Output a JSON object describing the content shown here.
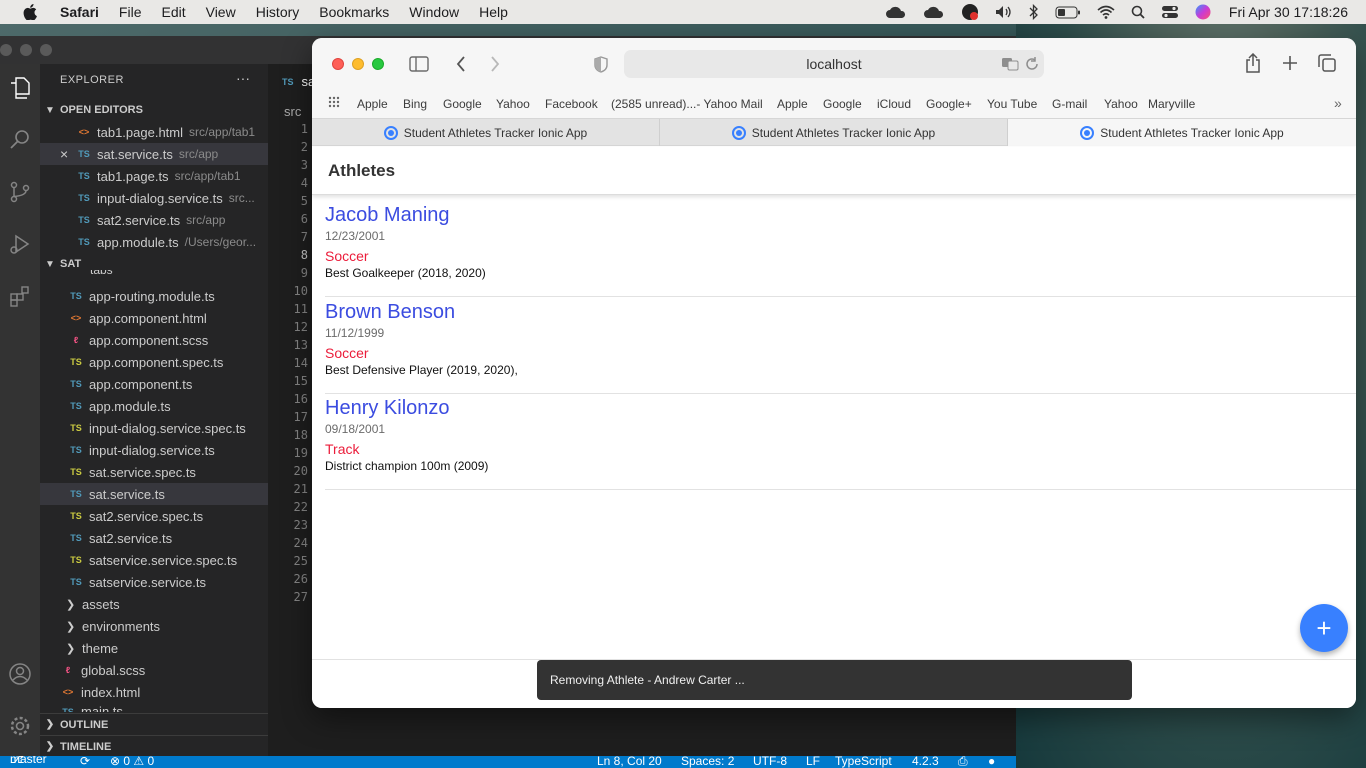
{
  "menubar": {
    "app": "Safari",
    "items": [
      "File",
      "Edit",
      "View",
      "History",
      "Bookmarks",
      "Window",
      "Help"
    ],
    "clock": "Fri Apr 30  17:18:26"
  },
  "vscode": {
    "explorer_title": "EXPLORER",
    "more": "···",
    "open_editors_title": "OPEN EDITORS",
    "open_editors": [
      {
        "name": "tab1.page.html",
        "path": "src/app/tab1",
        "kind": "html"
      },
      {
        "name": "sat.service.ts",
        "path": "src/app",
        "kind": "TS"
      },
      {
        "name": "tab1.page.ts",
        "path": "src/app/tab1",
        "kind": "TS"
      },
      {
        "name": "input-dialog.service.ts",
        "path": "src...",
        "kind": "TS"
      },
      {
        "name": "sat2.service.ts",
        "path": "src/app",
        "kind": "TS"
      },
      {
        "name": "app.module.ts",
        "path": "/Users/geor...",
        "kind": "TS"
      }
    ],
    "sat_title": "SAT",
    "partial_top": "tabs",
    "files": [
      {
        "name": "app-routing.module.ts",
        "kind": "TS"
      },
      {
        "name": "app.component.html",
        "kind": "html"
      },
      {
        "name": "app.component.scss",
        "kind": "scss"
      },
      {
        "name": "app.component.spec.ts",
        "kind": "TSy"
      },
      {
        "name": "app.component.ts",
        "kind": "TS"
      },
      {
        "name": "app.module.ts",
        "kind": "TS"
      },
      {
        "name": "input-dialog.service.spec.ts",
        "kind": "TSy"
      },
      {
        "name": "input-dialog.service.ts",
        "kind": "TS"
      },
      {
        "name": "sat.service.spec.ts",
        "kind": "TSy"
      },
      {
        "name": "sat.service.ts",
        "kind": "TS"
      },
      {
        "name": "sat2.service.spec.ts",
        "kind": "TSy"
      },
      {
        "name": "sat2.service.ts",
        "kind": "TS"
      },
      {
        "name": "satservice.service.spec.ts",
        "kind": "TSy"
      },
      {
        "name": "satservice.service.ts",
        "kind": "TS"
      }
    ],
    "folders": [
      "assets",
      "environments",
      "theme"
    ],
    "root_files": [
      {
        "name": "global.scss",
        "kind": "scss"
      },
      {
        "name": "index.html",
        "kind": "html"
      }
    ],
    "partial_bottom": "main.ts",
    "outline": "OUTLINE",
    "timeline": "TIMELINE",
    "editor_tab": "sa",
    "breadcrumb": "src",
    "line_numbers": [
      "1",
      "2",
      "3",
      "4",
      "5",
      "6",
      "7",
      "8",
      "9",
      "10",
      "11",
      "12",
      "13",
      "14",
      "15",
      "16",
      "17",
      "18",
      "19",
      "20",
      "21",
      "22",
      "23",
      "24",
      "25",
      "26",
      "27"
    ],
    "status": {
      "branch": "master",
      "problems": "⊗ 0 ⚠ 0",
      "position": "Ln 8, Col 20",
      "spaces": "Spaces: 2",
      "encoding": "UTF-8",
      "eol": "LF",
      "language": "TypeScript",
      "version": "4.2.3"
    }
  },
  "safari": {
    "url": "localhost",
    "bookmarks": [
      "Apple",
      "Bing",
      "Google",
      "Yahoo",
      "Facebook",
      "(2585 unread)...- Yahoo Mail",
      "Apple",
      "Google",
      "iCloud",
      "Google+",
      "You Tube",
      "G-mail",
      "Yahoo",
      "Maryville"
    ],
    "tabs": [
      "Student Athletes Tracker Ionic App",
      "Student Athletes Tracker Ionic App",
      "Student Athletes Tracker Ionic App"
    ],
    "active_tab": 2
  },
  "app": {
    "title": "Athletes",
    "athletes": [
      {
        "name": "Jacob Maning",
        "dob": "12/23/2001",
        "sport": "Soccer",
        "awards": "Best Goalkeeper (2018, 2020)"
      },
      {
        "name": "Brown Benson",
        "dob": "11/12/1999",
        "sport": "Soccer",
        "awards": "Best Defensive Player (2019, 2020),"
      },
      {
        "name": "Henry Kilonzo",
        "dob": "09/18/2001",
        "sport": "Track",
        "awards": "District champion 100m (2009)"
      }
    ],
    "fab_label": "+",
    "toast": "Removing Athlete - Andrew Carter ..."
  },
  "colors": {
    "ionic_primary": "#3880ff",
    "athlete_name": "#3b4ce0",
    "sport": "#eb1c3a",
    "vscode_status": "#007acc"
  }
}
